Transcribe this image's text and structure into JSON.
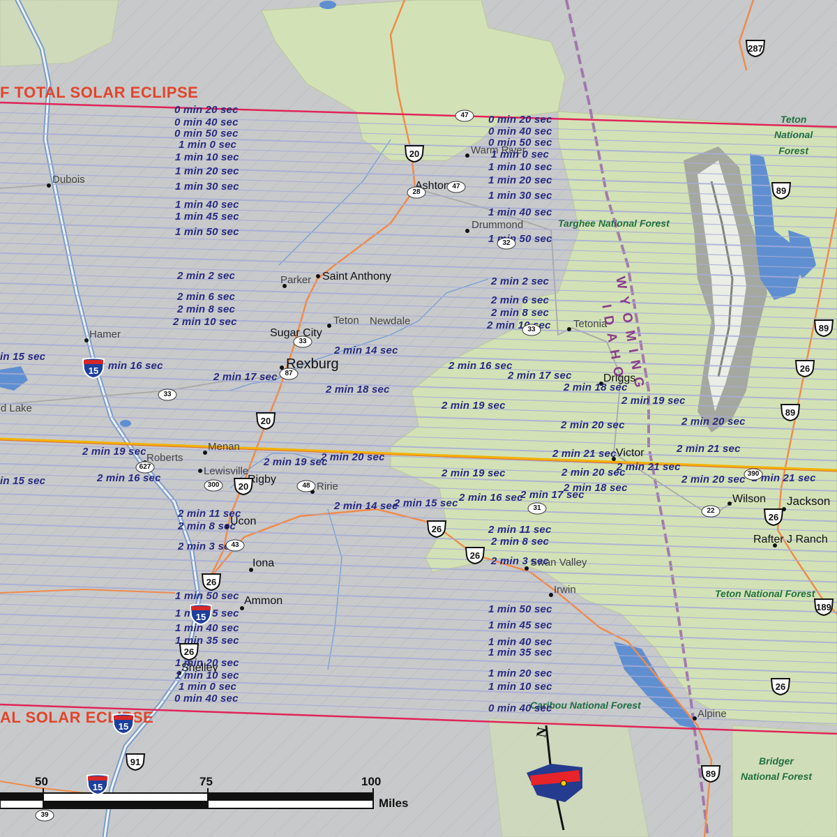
{
  "map": {
    "eclipse_labels": {
      "north": "F TOTAL SOLAR ECLIPSE",
      "south": "AL SOLAR ECLIPSE"
    },
    "states": {
      "wyoming": "WYOMING",
      "idaho": "IDAHO"
    },
    "forests": {
      "teton_ne": "Teton\nNational\nForest",
      "targhee": "Targhee National Forest",
      "teton_se": "Teton National Forest",
      "caribou": "Caribou National Forest",
      "bridger": "Bridger\nNational Forest"
    },
    "cities": {
      "dubois": "Dubois",
      "hamer": "Hamer",
      "ashton": "Ashton",
      "warm_river": "Warm River",
      "drummond": "Drummond",
      "parker": "Parker",
      "saint_anthony": "Saint Anthony",
      "teton": "Teton",
      "newdale": "Newdale",
      "sugar_city": "Sugar City",
      "rexburg": "Rexburg",
      "tetonia": "Tetonia",
      "driggs": "Driggs",
      "victor": "Victor",
      "menan": "Menan",
      "roberts": "Roberts",
      "lewisville": "Lewisville",
      "rigby": "Rigby",
      "ririe": "Ririe",
      "ucon": "Ucon",
      "iona": "Iona",
      "ammon": "Ammon",
      "shelley": "Shelley",
      "irwin": "Irwin",
      "swan_valley": "Swan Valley",
      "wilson": "Wilson",
      "jackson": "Jackson",
      "rafter_j": "Rafter J Ranch",
      "alpine": "Alpine",
      "mud_lake": "Mud Lake"
    },
    "durations": {
      "n_0_20": "0 min 20 sec",
      "n_0_40": "0 min 40 sec",
      "n_0_50": "0 min 50 sec",
      "n_1_0": "1 min 0 sec",
      "n_1_10": "1 min 10 sec",
      "n_1_20": "1 min 20 sec",
      "n_1_30": "1 min 30 sec",
      "n_1_40": "1 min 40 sec",
      "n_1_45": "1 min 45 sec",
      "n_1_50": "1 min 50 sec",
      "n_2_2": "2 min 2 sec",
      "n_2_6": "2 min 6 sec",
      "n_2_8": "2 min 8 sec",
      "n_2_10": "2 min 10 sec",
      "n_2_14": "2 min 14 sec",
      "n_2_15": "2 min 15 sec",
      "n_2_16": "2 min 16 sec",
      "n_2_17": "2 min 17 sec",
      "n_2_18": "2 min 18 sec",
      "n_2_19": "2 min 19 sec",
      "n_2_20": "2 min 20 sec",
      "n_2_21": "2 min 21 sec",
      "s_2_11": "2 min 11 sec",
      "s_2_8": "2 min 8 sec",
      "s_2_3": "2 min 3 sec",
      "s_1_35": "1 min 35 sec"
    },
    "highways": {
      "i15": "15",
      "us20": "20",
      "us26": "26",
      "us89": "89",
      "us287": "287",
      "us91": "91",
      "us189": "189",
      "sr47": "47",
      "sr32": "32",
      "sr33": "33",
      "sr22": "22",
      "sr31": "31",
      "sr48": "48",
      "sr43": "43",
      "sr39": "39",
      "sr300": "300",
      "sr390": "390",
      "sr627": "627",
      "sr28": "28",
      "sr87": "87"
    },
    "scale": {
      "t50": "50",
      "t75": "75",
      "t100": "100",
      "unit": "Miles"
    },
    "compass": {
      "north": "N"
    },
    "colors": {
      "path_band": "#a7acd8",
      "edge_line": "#e0245a",
      "center_line": "#f2b300",
      "duration_text": "#262a80",
      "forest_fill": "#d4e4b9",
      "state_line": "#8a5a98",
      "road": "#ef8b4c",
      "water": "#5f8fd0"
    }
  }
}
